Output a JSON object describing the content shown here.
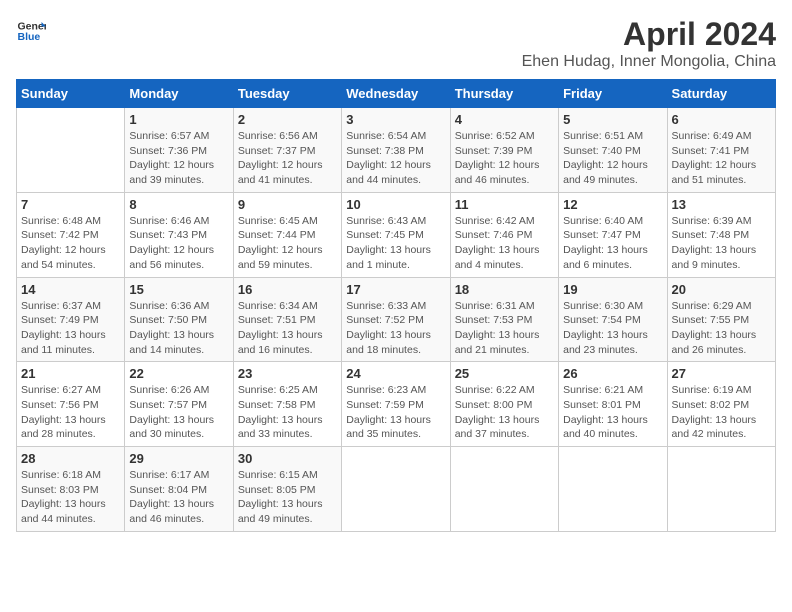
{
  "logo": {
    "text_general": "General",
    "text_blue": "Blue"
  },
  "title": "April 2024",
  "subtitle": "Ehen Hudag, Inner Mongolia, China",
  "days_of_week": [
    "Sunday",
    "Monday",
    "Tuesday",
    "Wednesday",
    "Thursday",
    "Friday",
    "Saturday"
  ],
  "weeks": [
    [
      {
        "day": "",
        "info": ""
      },
      {
        "day": "1",
        "info": "Sunrise: 6:57 AM\nSunset: 7:36 PM\nDaylight: 12 hours\nand 39 minutes."
      },
      {
        "day": "2",
        "info": "Sunrise: 6:56 AM\nSunset: 7:37 PM\nDaylight: 12 hours\nand 41 minutes."
      },
      {
        "day": "3",
        "info": "Sunrise: 6:54 AM\nSunset: 7:38 PM\nDaylight: 12 hours\nand 44 minutes."
      },
      {
        "day": "4",
        "info": "Sunrise: 6:52 AM\nSunset: 7:39 PM\nDaylight: 12 hours\nand 46 minutes."
      },
      {
        "day": "5",
        "info": "Sunrise: 6:51 AM\nSunset: 7:40 PM\nDaylight: 12 hours\nand 49 minutes."
      },
      {
        "day": "6",
        "info": "Sunrise: 6:49 AM\nSunset: 7:41 PM\nDaylight: 12 hours\nand 51 minutes."
      }
    ],
    [
      {
        "day": "7",
        "info": "Sunrise: 6:48 AM\nSunset: 7:42 PM\nDaylight: 12 hours\nand 54 minutes."
      },
      {
        "day": "8",
        "info": "Sunrise: 6:46 AM\nSunset: 7:43 PM\nDaylight: 12 hours\nand 56 minutes."
      },
      {
        "day": "9",
        "info": "Sunrise: 6:45 AM\nSunset: 7:44 PM\nDaylight: 12 hours\nand 59 minutes."
      },
      {
        "day": "10",
        "info": "Sunrise: 6:43 AM\nSunset: 7:45 PM\nDaylight: 13 hours\nand 1 minute."
      },
      {
        "day": "11",
        "info": "Sunrise: 6:42 AM\nSunset: 7:46 PM\nDaylight: 13 hours\nand 4 minutes."
      },
      {
        "day": "12",
        "info": "Sunrise: 6:40 AM\nSunset: 7:47 PM\nDaylight: 13 hours\nand 6 minutes."
      },
      {
        "day": "13",
        "info": "Sunrise: 6:39 AM\nSunset: 7:48 PM\nDaylight: 13 hours\nand 9 minutes."
      }
    ],
    [
      {
        "day": "14",
        "info": "Sunrise: 6:37 AM\nSunset: 7:49 PM\nDaylight: 13 hours\nand 11 minutes."
      },
      {
        "day": "15",
        "info": "Sunrise: 6:36 AM\nSunset: 7:50 PM\nDaylight: 13 hours\nand 14 minutes."
      },
      {
        "day": "16",
        "info": "Sunrise: 6:34 AM\nSunset: 7:51 PM\nDaylight: 13 hours\nand 16 minutes."
      },
      {
        "day": "17",
        "info": "Sunrise: 6:33 AM\nSunset: 7:52 PM\nDaylight: 13 hours\nand 18 minutes."
      },
      {
        "day": "18",
        "info": "Sunrise: 6:31 AM\nSunset: 7:53 PM\nDaylight: 13 hours\nand 21 minutes."
      },
      {
        "day": "19",
        "info": "Sunrise: 6:30 AM\nSunset: 7:54 PM\nDaylight: 13 hours\nand 23 minutes."
      },
      {
        "day": "20",
        "info": "Sunrise: 6:29 AM\nSunset: 7:55 PM\nDaylight: 13 hours\nand 26 minutes."
      }
    ],
    [
      {
        "day": "21",
        "info": "Sunrise: 6:27 AM\nSunset: 7:56 PM\nDaylight: 13 hours\nand 28 minutes."
      },
      {
        "day": "22",
        "info": "Sunrise: 6:26 AM\nSunset: 7:57 PM\nDaylight: 13 hours\nand 30 minutes."
      },
      {
        "day": "23",
        "info": "Sunrise: 6:25 AM\nSunset: 7:58 PM\nDaylight: 13 hours\nand 33 minutes."
      },
      {
        "day": "24",
        "info": "Sunrise: 6:23 AM\nSunset: 7:59 PM\nDaylight: 13 hours\nand 35 minutes."
      },
      {
        "day": "25",
        "info": "Sunrise: 6:22 AM\nSunset: 8:00 PM\nDaylight: 13 hours\nand 37 minutes."
      },
      {
        "day": "26",
        "info": "Sunrise: 6:21 AM\nSunset: 8:01 PM\nDaylight: 13 hours\nand 40 minutes."
      },
      {
        "day": "27",
        "info": "Sunrise: 6:19 AM\nSunset: 8:02 PM\nDaylight: 13 hours\nand 42 minutes."
      }
    ],
    [
      {
        "day": "28",
        "info": "Sunrise: 6:18 AM\nSunset: 8:03 PM\nDaylight: 13 hours\nand 44 minutes."
      },
      {
        "day": "29",
        "info": "Sunrise: 6:17 AM\nSunset: 8:04 PM\nDaylight: 13 hours\nand 46 minutes."
      },
      {
        "day": "30",
        "info": "Sunrise: 6:15 AM\nSunset: 8:05 PM\nDaylight: 13 hours\nand 49 minutes."
      },
      {
        "day": "",
        "info": ""
      },
      {
        "day": "",
        "info": ""
      },
      {
        "day": "",
        "info": ""
      },
      {
        "day": "",
        "info": ""
      }
    ]
  ]
}
